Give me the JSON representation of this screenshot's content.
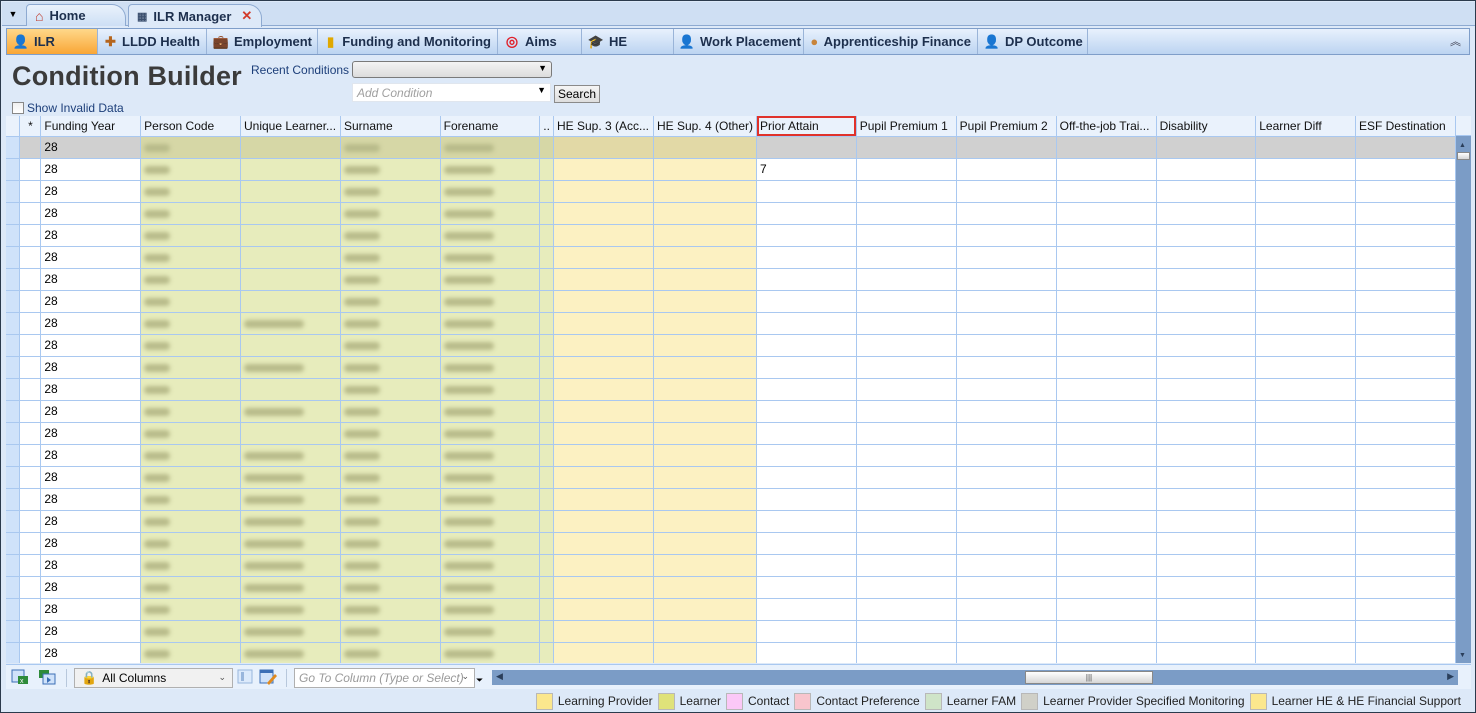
{
  "tabs": [
    {
      "label": "Home",
      "icon": "home-icon"
    },
    {
      "label": "ILR Manager",
      "icon": "grid-icon",
      "closable": true,
      "active": true
    }
  ],
  "ribbon": {
    "tabs": [
      {
        "label": "ILR",
        "icon": "learner-icon",
        "active": true
      },
      {
        "label": "LLDD Health",
        "icon": "lldd-health-icon"
      },
      {
        "label": "Employment",
        "icon": "employment-icon"
      },
      {
        "label": "Funding and Monitoring",
        "icon": "funding-icon"
      },
      {
        "label": "Aims",
        "icon": "target-icon"
      },
      {
        "label": "HE",
        "icon": "mortarboard-icon"
      },
      {
        "label": "Work Placement",
        "icon": "work-placement-icon"
      },
      {
        "label": "Apprenticeship Finance",
        "icon": "apprenticeship-finance-icon"
      },
      {
        "label": "DP Outcome",
        "icon": "dp-outcome-icon"
      }
    ],
    "collapse_glyph": "︽"
  },
  "condition_builder": {
    "title": "Condition Builder",
    "recent_label": "Recent Conditions",
    "recent_value": "",
    "add_condition_placeholder": "Add Condition",
    "search_label": "Search",
    "show_invalid_label": "Show Invalid Data",
    "show_invalid_checked": false
  },
  "grid": {
    "columns": [
      {
        "label": "*",
        "group": "rowheader"
      },
      {
        "label": "Funding Year",
        "group": "plain"
      },
      {
        "label": "Person Code",
        "group": "learner"
      },
      {
        "label": "Unique Learner...",
        "group": "learner"
      },
      {
        "label": "Surname",
        "group": "learner"
      },
      {
        "label": "Forename",
        "group": "learner"
      },
      {
        "label": "..",
        "group": "gap"
      },
      {
        "label": "HE Sup. 3 (Acc...",
        "group": "hefs"
      },
      {
        "label": "HE Sup. 4 (Other)",
        "group": "hefs"
      },
      {
        "label": "Prior Attain",
        "group": "plain",
        "selected": true
      },
      {
        "label": "Pupil Premium 1",
        "group": "plain"
      },
      {
        "label": "Pupil Premium 2",
        "group": "plain"
      },
      {
        "label": "Off-the-job Trai...",
        "group": "plain"
      },
      {
        "label": "Disability",
        "group": "plain"
      },
      {
        "label": "Learner Diff",
        "group": "plain"
      },
      {
        "label": "ESF Destination",
        "group": "plain"
      }
    ],
    "redacted_note": "Person Code, Unique Learner Number, Surname and Forename values are blurred",
    "rows": [
      {
        "funding_year": "28",
        "prior_attain": "",
        "current": true,
        "uln_present": false
      },
      {
        "funding_year": "28",
        "prior_attain": "7",
        "uln_present": false
      },
      {
        "funding_year": "28",
        "prior_attain": "",
        "uln_present": false
      },
      {
        "funding_year": "28",
        "prior_attain": "",
        "uln_present": false
      },
      {
        "funding_year": "28",
        "prior_attain": "",
        "uln_present": false
      },
      {
        "funding_year": "28",
        "prior_attain": "",
        "uln_present": false
      },
      {
        "funding_year": "28",
        "prior_attain": "",
        "uln_present": false
      },
      {
        "funding_year": "28",
        "prior_attain": "",
        "uln_present": false
      },
      {
        "funding_year": "28",
        "prior_attain": "",
        "uln_present": true
      },
      {
        "funding_year": "28",
        "prior_attain": "",
        "uln_present": false
      },
      {
        "funding_year": "28",
        "prior_attain": "",
        "uln_present": true
      },
      {
        "funding_year": "28",
        "prior_attain": "",
        "uln_present": false
      },
      {
        "funding_year": "28",
        "prior_attain": "",
        "uln_present": true
      },
      {
        "funding_year": "28",
        "prior_attain": "",
        "uln_present": false
      },
      {
        "funding_year": "28",
        "prior_attain": "",
        "uln_present": true
      },
      {
        "funding_year": "28",
        "prior_attain": "",
        "uln_present": true
      },
      {
        "funding_year": "28",
        "prior_attain": "",
        "uln_present": true
      },
      {
        "funding_year": "28",
        "prior_attain": "",
        "uln_present": true
      },
      {
        "funding_year": "28",
        "prior_attain": "",
        "uln_present": true
      },
      {
        "funding_year": "28",
        "prior_attain": "",
        "uln_present": true
      },
      {
        "funding_year": "28",
        "prior_attain": "",
        "uln_present": true
      },
      {
        "funding_year": "28",
        "prior_attain": "",
        "uln_present": true
      },
      {
        "funding_year": "28",
        "prior_attain": "",
        "uln_present": true
      },
      {
        "funding_year": "28",
        "prior_attain": "",
        "uln_present": true
      },
      {
        "funding_year": "28",
        "prior_attain": "",
        "uln_present": true
      }
    ]
  },
  "bottom_toolbar": {
    "column_set_value": "All Columns",
    "goto_column_placeholder": "Go To Column (Type or Select)"
  },
  "legend": [
    {
      "label": "Learning Provider",
      "color": "#fbe78d"
    },
    {
      "label": "Learner",
      "color": "#dfe27a"
    },
    {
      "label": "Contact",
      "color": "#fbc8f7"
    },
    {
      "label": "Contact Preference",
      "color": "#f8c5cd"
    },
    {
      "label": "Learner FAM",
      "color": "#cfe4c8"
    },
    {
      "label": "Learner Provider Specified Monitoring",
      "color": "#d0d0c8"
    },
    {
      "label": "Learner HE & HE Financial Support",
      "color": "#fbe78d"
    }
  ],
  "colors": {
    "active_ribbon_tab": "#f9a636",
    "selected_header_outline": "#e0322b",
    "learner_cell": "#e7ecbc",
    "he_support_cell": "#fcf1c2"
  }
}
